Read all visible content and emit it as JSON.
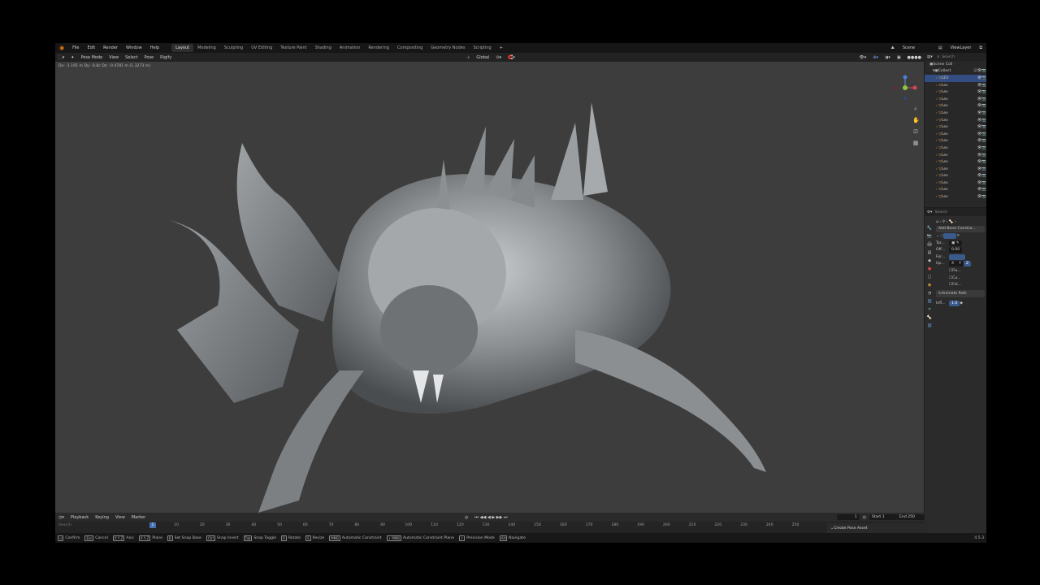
{
  "menu": {
    "file": "File",
    "edit": "Edit",
    "render": "Render",
    "window": "Window",
    "help": "Help"
  },
  "workspaces": [
    "Layout",
    "Modeling",
    "Sculpting",
    "UV Editing",
    "Texture Paint",
    "Shading",
    "Animation",
    "Rendering",
    "Compositing",
    "Geometry Nodes",
    "Scripting"
  ],
  "topright": {
    "scene": "Scene",
    "view_layer": "ViewLayer"
  },
  "viewport_header": {
    "mode": "Pose Mode",
    "view": "View",
    "select": "Select",
    "pose": "Pose",
    "rigify": "Rigify",
    "orientation": "Global"
  },
  "viewport": {
    "status_line": "Dx: -1.191 m  Dy: -0.8c  Dz: -0.4781 m (1.3273 m)"
  },
  "outliner": {
    "search_placeholder": "Search",
    "root": "Scene Coll",
    "collection": "Collect",
    "items": [
      "LEV",
      "Lev",
      "Lev",
      "Lev",
      "Lev",
      "Lev",
      "Lev",
      "Lev",
      "Lev",
      "Lev",
      "Lev",
      "Lev",
      "Lev",
      "Lev",
      "Lev",
      "Lev",
      "Lev",
      "Lev"
    ]
  },
  "properties": {
    "search_placeholder": "Search",
    "add_constraint": "Add Bone Constra...",
    "target_label": "Tar...",
    "offset_label": "Off...",
    "offset_value": "0.00",
    "forward_label": "For...",
    "up_label": "Up...",
    "up_axes": [
      "X",
      "Y",
      "Z"
    ],
    "checkboxes": [
      "Fix...",
      "Cu...",
      "Fol..."
    ],
    "animate_path": "Animate Path",
    "influence_label": "Infl...",
    "influence_value": "1.0"
  },
  "timeline": {
    "playback": "Playback",
    "keying": "Keying",
    "view": "View",
    "marker": "Marker",
    "current_frame": "1",
    "start_label": "Start",
    "start_value": "1",
    "end_label": "End",
    "end_value": "250",
    "search_placeholder": "Search",
    "frame_marker": "1",
    "ticks": [
      "10",
      "20",
      "30",
      "40",
      "50",
      "60",
      "70",
      "80",
      "90",
      "100",
      "110",
      "120",
      "130",
      "140",
      "150",
      "160",
      "170",
      "180",
      "190",
      "200",
      "210",
      "220",
      "230",
      "240",
      "250"
    ],
    "create_pose_asset": "Create Pose Asset"
  },
  "statusbar": {
    "items": [
      {
        "key": "⏎",
        "label": "Confirm"
      },
      {
        "key": "Esc",
        "label": "Cancel"
      },
      {
        "key": "X Y Z",
        "label": "Axis"
      },
      {
        "key": "X Y Z",
        "label": "Plane"
      },
      {
        "key": "B",
        "label": "Set Snap Base"
      },
      {
        "key": "Ctrl",
        "label": "Snap Invert"
      },
      {
        "key": "Tab",
        "label": "Snap Toggle"
      },
      {
        "key": "R",
        "label": "Rotate"
      },
      {
        "key": "S",
        "label": "Resize"
      },
      {
        "key": "MMB",
        "label": "Automatic Constraint"
      },
      {
        "key": "⇧ MMB",
        "label": "Automatic Constraint Plane"
      },
      {
        "key": "⇧",
        "label": "Precision Mode"
      },
      {
        "key": "Alt",
        "label": "Navigate"
      }
    ],
    "version": "4.5.3"
  }
}
